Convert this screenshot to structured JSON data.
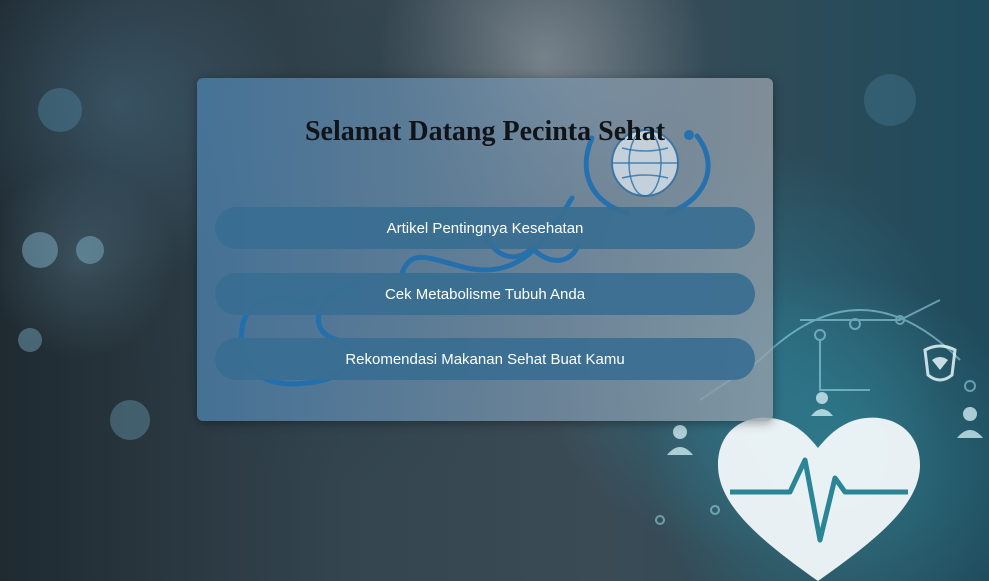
{
  "page": {
    "title": "Selamat Datang Pecinta Sehat"
  },
  "menu": {
    "items": [
      {
        "label": "Artikel Pentingnya Kesehatan"
      },
      {
        "label": "Cek Metabolisme Tubuh Anda"
      },
      {
        "label": "Rekomendasi Makanan Sehat Buat Kamu"
      }
    ]
  },
  "colors": {
    "card_gradient_start": "#4878a0",
    "card_gradient_end": "#96a0aa",
    "button_bg": "#386e91",
    "button_text": "#ffffff",
    "title_text": "#101418",
    "accent_blue": "#1e6fb0",
    "heart_white": "#f2f8fa"
  },
  "icons": {
    "background_heart": "heart-pulse-icon",
    "card_stethoscope": "stethoscope-icon",
    "globe": "globe-icon"
  }
}
